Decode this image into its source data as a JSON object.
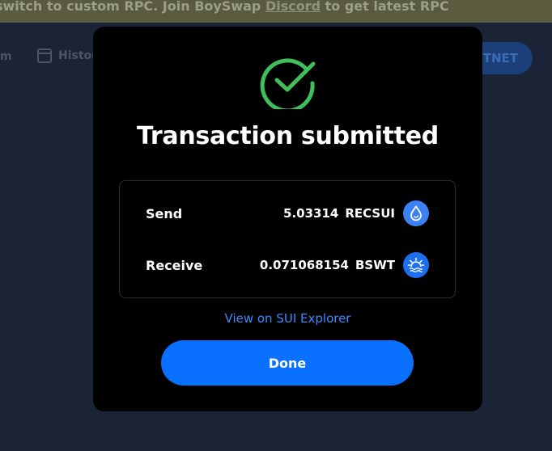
{
  "banner": {
    "text_before": "switch to custom RPC. Join BoySwap ",
    "link": "Discord",
    "text_after": " to get latest RPC"
  },
  "nav": {
    "left_fragment": "m",
    "history_label": "Histor",
    "network_button_fragment": "TNET"
  },
  "modal": {
    "title": "Transaction submitted",
    "send": {
      "label": "Send",
      "amount": "5.03314",
      "token": "RECSUI",
      "icon": "sui-drop-icon"
    },
    "receive": {
      "label": "Receive",
      "amount": "0.071068154",
      "token": "BSWT",
      "icon": "bswt-sunrise-icon"
    },
    "explorer_link": "View on SUI Explorer",
    "done_label": "Done"
  },
  "colors": {
    "success_green": "#3fbf5a",
    "primary_blue": "#0a70ff",
    "link_blue": "#3b8bff"
  }
}
